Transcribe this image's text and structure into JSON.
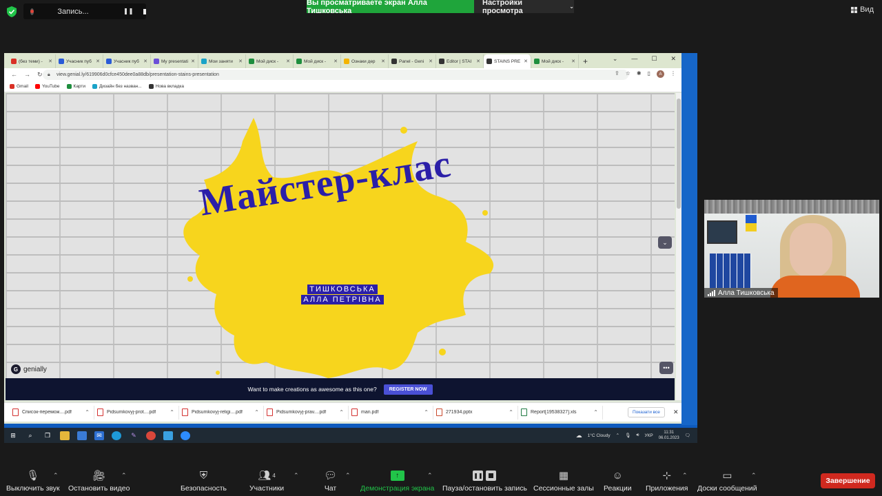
{
  "zoom_top": {
    "recording_label": "Запись...",
    "share_banner": "Вы просматриваете экран Алла Тишковська",
    "view_options": "Настройки просмотра",
    "view_label": "Вид"
  },
  "browser": {
    "tabs": [
      {
        "label": "(без теми) -",
        "color": "#d93025"
      },
      {
        "label": "Учасник пуб",
        "color": "#2a5bd7"
      },
      {
        "label": "Учасник пуб",
        "color": "#2a5bd7"
      },
      {
        "label": "My presentati",
        "color": "#6b4fd8"
      },
      {
        "label": "Мои заняти",
        "color": "#1aa3c8"
      },
      {
        "label": "Мой диск -",
        "color": "#1e8e3e"
      },
      {
        "label": "Мой диск -",
        "color": "#1e8e3e"
      },
      {
        "label": "Ознаки дер",
        "color": "#f4b400"
      },
      {
        "label": "Panel - Geni",
        "color": "#333333"
      },
      {
        "label": "Editor | STAI",
        "color": "#333333"
      },
      {
        "label": "STAINS PRE",
        "color": "#333333"
      },
      {
        "label": "Мой диск -",
        "color": "#1e8e3e"
      }
    ],
    "url": "view.genial.ly/619906d0cfce450dee0a88db/presentation-stains-presentation",
    "bookmarks": [
      {
        "label": "Gmail",
        "color": "#d93025"
      },
      {
        "label": "YouTube",
        "color": "#ff0000"
      },
      {
        "label": "Карти",
        "color": "#1e8e3e"
      },
      {
        "label": "Дизайн без назван...",
        "color": "#1aa3c8"
      },
      {
        "label": "Нова вкладка",
        "color": "#333333"
      }
    ]
  },
  "presentation": {
    "title": "Майстер-клас",
    "author_line1": "ТИШКОВСЬКА",
    "author_line2": "АЛЛА ПЕТРІВНА",
    "brand": "genially",
    "register_text": "Want to make creations as awesome as this one?",
    "register_button": "REGISTER NOW"
  },
  "downloads": {
    "items": [
      {
        "name": "Список-перемож....pdf",
        "type": "pdf"
      },
      {
        "name": "Pidsumkovyj-prot....pdf",
        "type": "pdf"
      },
      {
        "name": "Pidsumkovyj-religi....pdf",
        "type": "pdf"
      },
      {
        "name": "Pidsumkovyj-prav....pdf",
        "type": "pdf"
      },
      {
        "name": "man.pdf",
        "type": "pdf"
      },
      {
        "name": "271934.pptx",
        "type": "pptx"
      },
      {
        "name": "Report[19538327].xls",
        "type": "xls"
      }
    ],
    "show_all": "Показати все"
  },
  "taskbar": {
    "weather": "1°C Cloudy",
    "lang": "УКР",
    "time": "11:31",
    "date": "06.01.2023"
  },
  "participant": {
    "name": "Алла Тишковська"
  },
  "toolbar": {
    "mute": "Выключить звук",
    "video": "Остановить видео",
    "security": "Безопасность",
    "participants": "Участники",
    "participants_count": "4",
    "chat": "Чат",
    "share": "Демонстрация экрана",
    "pause_record": "Пауза/остановить запись",
    "breakout": "Сессионные залы",
    "reactions": "Реакции",
    "apps": "Приложения",
    "whiteboards": "Доски сообщений",
    "end": "Завершение"
  },
  "colors": {
    "zoom_green": "#1fa53b",
    "title_blue": "#2b1fa8",
    "splat_yellow": "#f7d51d",
    "end_red": "#d0291f"
  }
}
